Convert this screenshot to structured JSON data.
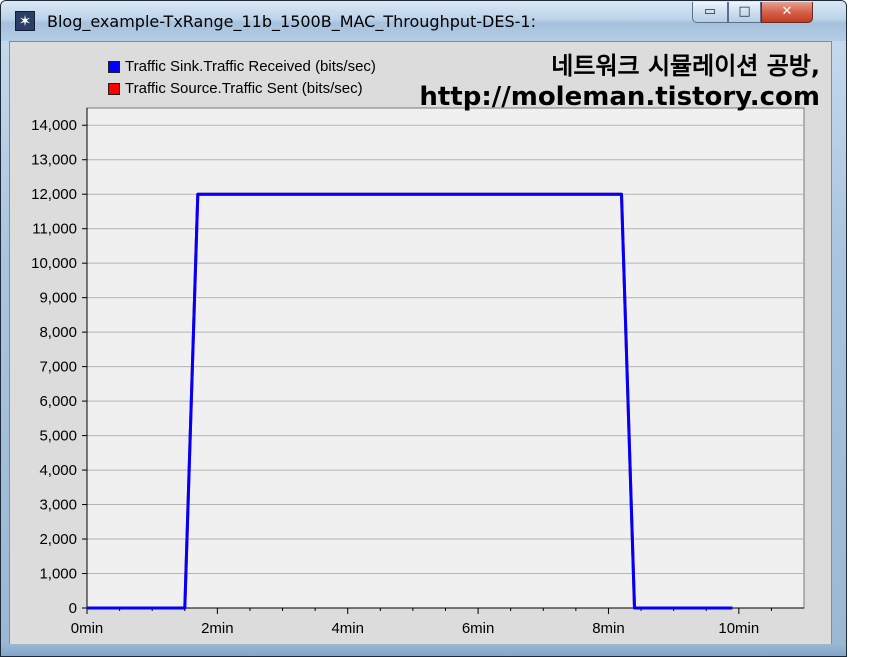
{
  "window": {
    "title": "Blog_example-TxRange_11b_1500B_MAC_Throughput-DES-1:",
    "icon": "star-burst-icon",
    "minimize_glyph": "▭",
    "maximize_glyph": "□",
    "close_glyph": "✕"
  },
  "watermark": {
    "line1": "네트워크 시뮬레이션 공방,",
    "line2": "http://moleman.tistory.com"
  },
  "legend": [
    {
      "label": "Traffic Sink.Traffic Received (bits/sec)",
      "color": "#0000ff"
    },
    {
      "label": "Traffic Source.Traffic Sent (bits/sec)",
      "color": "#ff0000"
    }
  ],
  "chart_data": {
    "type": "line",
    "title": "",
    "xlabel": "",
    "ylabel": "",
    "xlim": [
      0,
      11
    ],
    "ylim": [
      0,
      14500
    ],
    "x_ticks": [
      0,
      2,
      4,
      6,
      8,
      10
    ],
    "x_tick_labels": [
      "0min",
      "2min",
      "4min",
      "6min",
      "8min",
      "10min"
    ],
    "y_ticks": [
      0,
      1000,
      2000,
      3000,
      4000,
      5000,
      6000,
      7000,
      8000,
      9000,
      10000,
      11000,
      12000,
      13000,
      14000
    ],
    "y_tick_labels": [
      "0",
      "1,000",
      "2,000",
      "3,000",
      "4,000",
      "5,000",
      "6,000",
      "7,000",
      "8,000",
      "9,000",
      "10,000",
      "11,000",
      "12,000",
      "13,000",
      "14,000"
    ],
    "grid": true,
    "legend_position": "top-left",
    "plot_background": "#f0f0f0",
    "series": [
      {
        "name": "Traffic Sink.Traffic Received (bits/sec)",
        "color": "#0000ff",
        "x": [
          0,
          1.5,
          1.7,
          8.2,
          8.4,
          9.9
        ],
        "y": [
          0,
          0,
          12000,
          12000,
          0,
          0
        ]
      },
      {
        "name": "Traffic Source.Traffic Sent (bits/sec)",
        "color": "#ff0000",
        "x": [
          0,
          1.5,
          1.7,
          8.2,
          8.4,
          9.9
        ],
        "y": [
          0,
          0,
          12000,
          12000,
          0,
          0
        ]
      }
    ]
  }
}
